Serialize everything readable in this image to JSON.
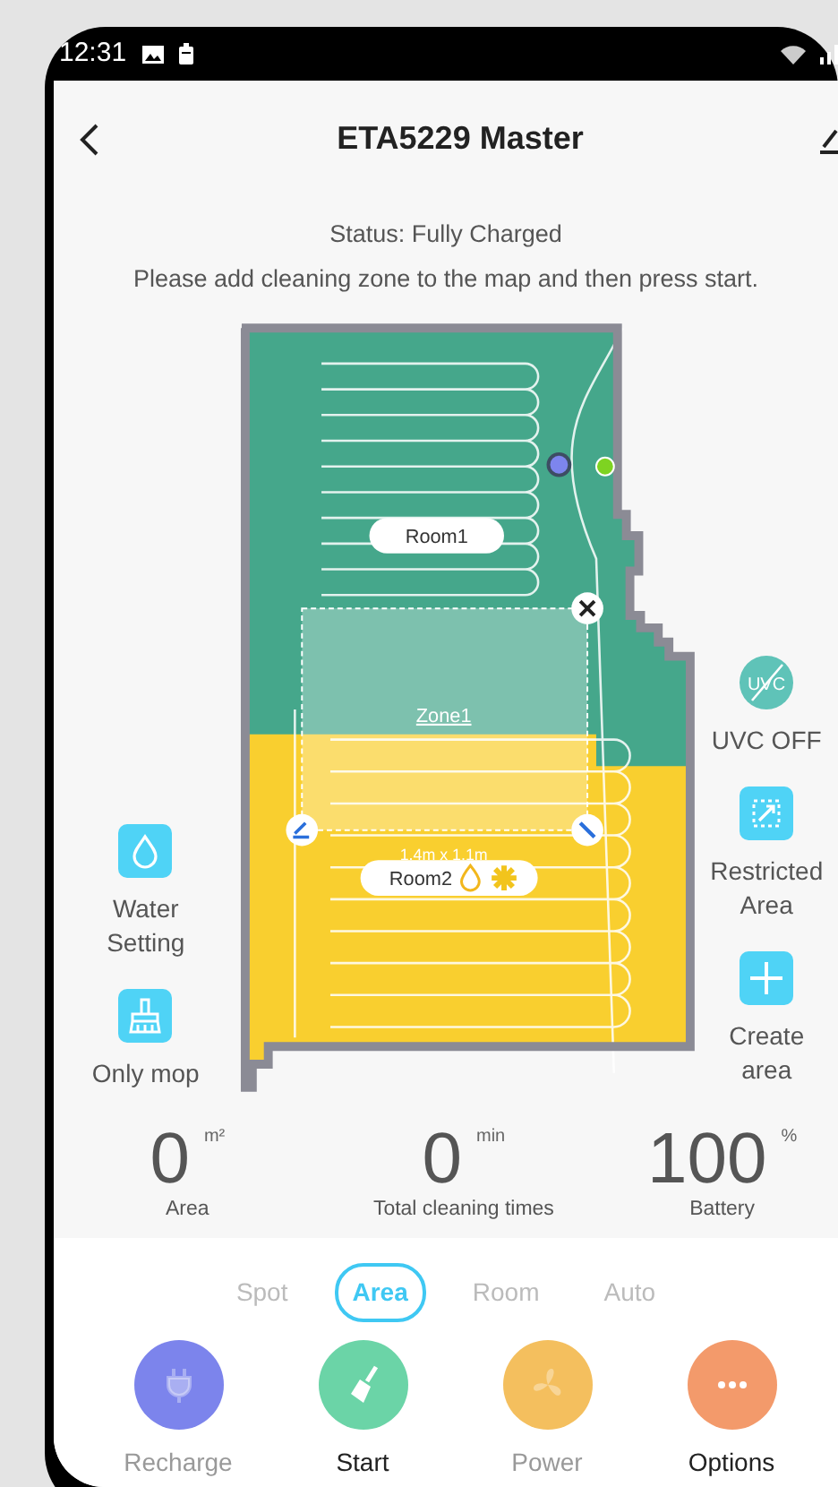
{
  "status_bar": {
    "time": "12:31"
  },
  "header": {
    "title": "ETA5229 Master"
  },
  "status": "Status: Fully Charged",
  "instruction": "Please add cleaning zone to the map and then press start.",
  "map": {
    "rooms": [
      {
        "label": "Room1",
        "color": "#45a78b",
        "has_settings": false
      },
      {
        "label": "Room2",
        "color": "#f9cf2f",
        "has_settings": true
      }
    ],
    "zone": {
      "label": "Zone1",
      "size": "1.4m x 1.1m"
    }
  },
  "left_tools": [
    {
      "kind": "water",
      "label": "Water Setting"
    },
    {
      "kind": "mop",
      "label": "Only mop"
    }
  ],
  "right_tools": [
    {
      "kind": "uvc",
      "label": "UVC OFF",
      "icon_text": "UVC"
    },
    {
      "kind": "restricted",
      "label": "Restricted Area"
    },
    {
      "kind": "create",
      "label": "Create area"
    }
  ],
  "stats": [
    {
      "value": "0",
      "unit": "m²",
      "label": "Area"
    },
    {
      "value": "0",
      "unit": "min",
      "label": "Total cleaning times"
    },
    {
      "value": "100",
      "unit": "%",
      "label": "Battery"
    }
  ],
  "modes": [
    {
      "label": "Spot",
      "selected": false
    },
    {
      "label": "Area",
      "selected": true
    },
    {
      "label": "Room",
      "selected": false
    },
    {
      "label": "Auto",
      "selected": false
    }
  ],
  "actions": [
    {
      "kind": "plug",
      "label": "Recharge",
      "color": "#7c84ec",
      "disabled": true
    },
    {
      "kind": "broom",
      "label": "Start",
      "color": "#6bd4a7",
      "disabled": false
    },
    {
      "kind": "fan",
      "label": "Power",
      "color": "#f4bf5e",
      "disabled": true
    },
    {
      "kind": "dots",
      "label": "Options",
      "color": "#f39a6b",
      "disabled": false
    }
  ]
}
